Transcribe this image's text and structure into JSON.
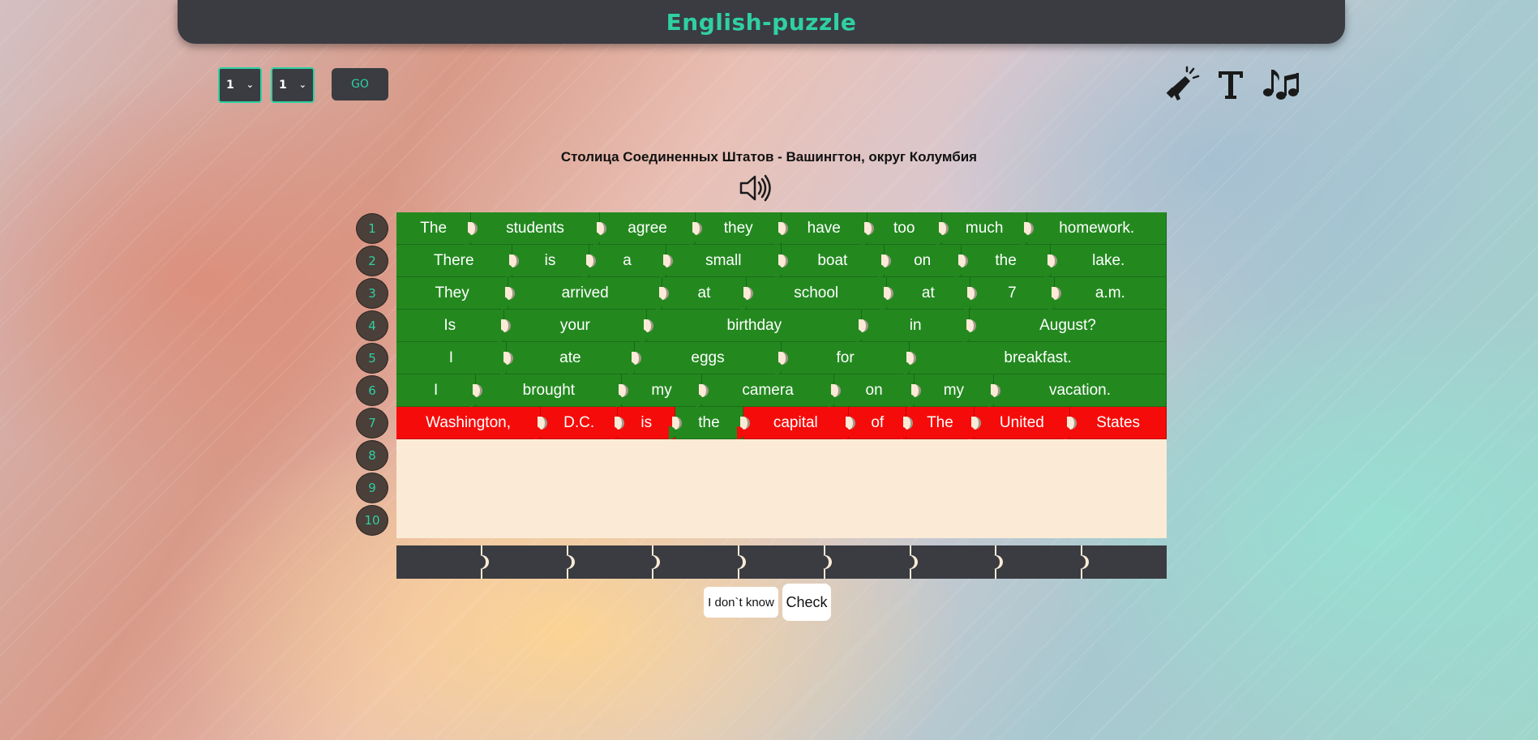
{
  "header": {
    "title": "English-puzzle"
  },
  "controls": {
    "level_value": "1",
    "page_value": "1",
    "go_label": "GO"
  },
  "toolbar": {
    "icons": [
      "megaphone-icon",
      "text-icon",
      "music-notes-icon"
    ]
  },
  "hint": {
    "translation": "Столица Соединенных Штатов - Вашингтон, округ Колумбия"
  },
  "row_numbers": [
    "1",
    "2",
    "3",
    "4",
    "5",
    "6",
    "7",
    "8",
    "9",
    "10"
  ],
  "rows": [
    {
      "words": [
        "The",
        "students",
        "agree",
        "they",
        "have",
        "too",
        "much",
        "homework."
      ],
      "status": "green"
    },
    {
      "words": [
        "There",
        "is",
        "a",
        "small",
        "boat",
        "on",
        "the",
        "lake."
      ],
      "status": "green"
    },
    {
      "words": [
        "They",
        "arrived",
        "at",
        "school",
        "at",
        "7",
        "a.m."
      ],
      "status": "green"
    },
    {
      "words": [
        "Is",
        "your",
        "birthday",
        "in",
        "August?"
      ],
      "status": "green"
    },
    {
      "words": [
        "I",
        "ate",
        "eggs",
        "for",
        "breakfast."
      ],
      "status": "green"
    },
    {
      "words": [
        "I",
        "brought",
        "my",
        "camera",
        "on",
        "my",
        "vacation."
      ],
      "status": "green"
    },
    {
      "words": [
        "Washington,",
        "D.C.",
        "is",
        "the",
        "capital",
        "of",
        "The",
        "United",
        "States"
      ],
      "status_per_word": [
        "red",
        "red",
        "red",
        "green",
        "red",
        "red",
        "red",
        "red",
        "red"
      ]
    }
  ],
  "colors": {
    "correct": "#23891f",
    "wrong": "#f50c0a",
    "accent": "#2fd0a2",
    "dark": "#3a3c41"
  },
  "actions": {
    "dont_know_label": "I don`t know",
    "check_label": "Check"
  }
}
